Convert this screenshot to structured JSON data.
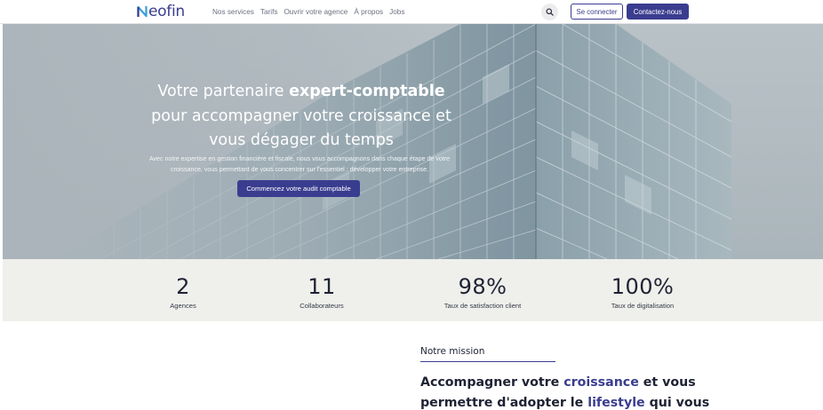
{
  "header": {
    "brand": "Neofin",
    "brand_rest": "eofin",
    "nav": [
      "Nos services",
      "Tarifs",
      "Ouvrir votre agence",
      "À propos",
      "Jobs"
    ],
    "search_icon": "search-icon",
    "login_label": "Se connecter",
    "contact_label": "Contactez-nous"
  },
  "hero": {
    "title_part1": "Votre partenaire ",
    "title_bold": "expert-comptable",
    "title_part2": "pour accompagner votre croissance et vous dégager du temps",
    "subtitle": "Avec notre expertise en gestion financière et fiscale, nous vous accompagnons dans chaque étape de votre croissance, vous permettant de vous concentrer sur l'essentiel : développer votre entreprise.",
    "cta_label": "Commencez votre audit comptable"
  },
  "stats": [
    {
      "value": "2",
      "label": "Agences"
    },
    {
      "value": "11",
      "label": "Collaborateurs"
    },
    {
      "value": "98%",
      "label": "Taux de satisfaction client"
    },
    {
      "value": "100%",
      "label": "Taux de digitalisation"
    }
  ],
  "mission": {
    "kicker": "Notre mission",
    "title_a": "Accompagner votre ",
    "title_hl1": "croissance",
    "title_b": " et vous permettre d'adopter le ",
    "title_hl2": "lifestyle",
    "title_c": " qui vous"
  },
  "colors": {
    "brand": "#3a3d8f",
    "stats_bg": "#efefeb",
    "text": "#1e2233"
  }
}
